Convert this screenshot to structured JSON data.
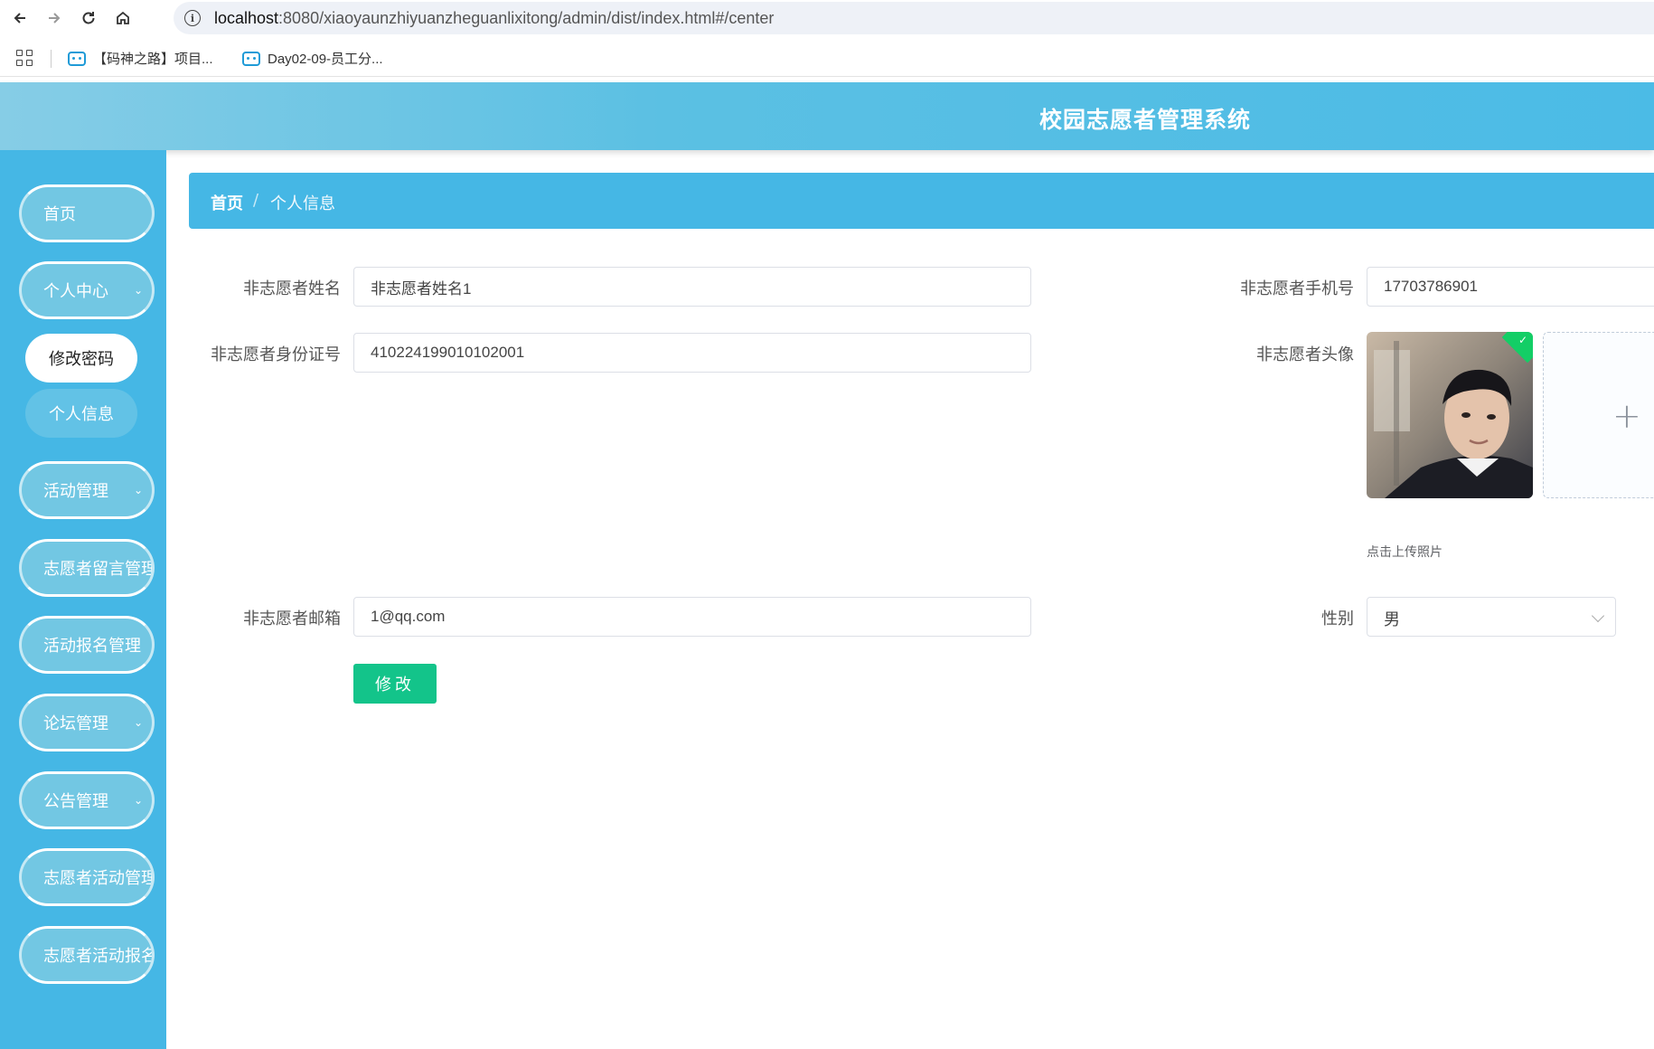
{
  "browser": {
    "url_host": "localhost",
    "url_path": ":8080/xiaoyaunzhiyuanzheguanlixitong/admin/dist/index.html#/center",
    "bookmarks": [
      {
        "label": "【码神之路】项目..."
      },
      {
        "label": "Day02-09-员工分..."
      }
    ]
  },
  "header": {
    "title": "校园志愿者管理系统"
  },
  "sidebar": {
    "items": [
      {
        "label": "首页"
      },
      {
        "label": "个人中心"
      },
      {
        "label": "活动管理"
      },
      {
        "label": "志愿者留言管理"
      },
      {
        "label": "活动报名管理"
      },
      {
        "label": "论坛管理"
      },
      {
        "label": "公告管理"
      },
      {
        "label": "志愿者活动管理"
      },
      {
        "label": "志愿者活动报名管理"
      }
    ],
    "submenu": [
      {
        "label": "修改密码",
        "active": true
      },
      {
        "label": "个人信息",
        "active": false
      }
    ]
  },
  "breadcrumb": {
    "home": "首页",
    "separator": "/",
    "current": "个人信息"
  },
  "form": {
    "name_label": "非志愿者姓名",
    "name_value": "非志愿者姓名1",
    "phone_label": "非志愿者手机号",
    "phone_value": "17703786901",
    "idcard_label": "非志愿者身份证号",
    "idcard_value": "410224199010102001",
    "avatar_label": "非志愿者头像",
    "upload_hint": "点击上传照片",
    "email_label": "非志愿者邮箱",
    "email_value": "1@qq.com",
    "gender_label": "性别",
    "gender_value": "男",
    "submit_label": "修改"
  },
  "colors": {
    "accent": "#45b7e5",
    "submit": "#13c48a",
    "success_badge": "#13ce66"
  }
}
